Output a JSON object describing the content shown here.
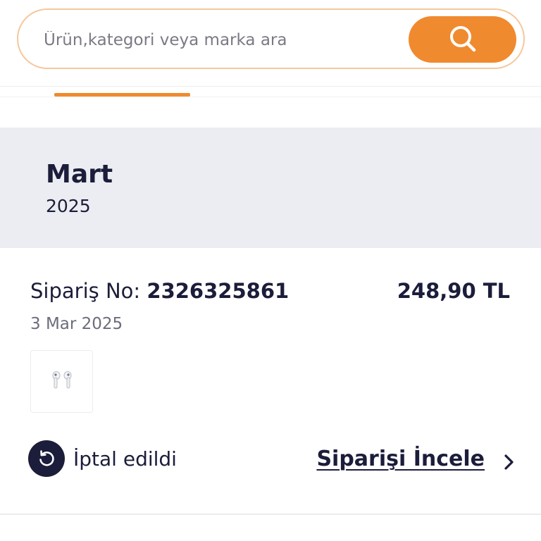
{
  "search": {
    "placeholder": "Ürün,kategori veya marka ara",
    "icon": "search-icon",
    "accent_color": "#f08a2e",
    "border_color": "#f6c79c"
  },
  "tabs": {
    "active_indicator_color": "#f08a2e"
  },
  "month_group": {
    "month": "Mart",
    "year": "2025"
  },
  "order": {
    "order_no_label": "Sipariş No:",
    "order_no": "2326325861",
    "price": "248,90 TL",
    "date": "3 Mar 2025",
    "product_icon": "earbuds-icon",
    "status_icon": "cancelled-undo-icon",
    "status": "İptal edildi",
    "review_link": "Siparişi İncele",
    "review_icon": "chevron-right-icon"
  },
  "colors": {
    "text_primary": "#1b1d3a",
    "text_secondary": "#6c6d7c",
    "section_bg": "#ecedf2"
  }
}
